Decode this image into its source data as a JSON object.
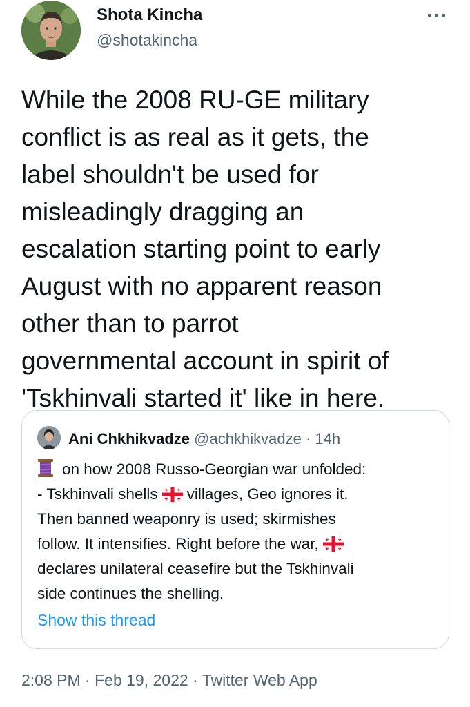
{
  "tweet": {
    "author_name": "Shota Kincha",
    "author_handle": "@shotakincha",
    "text_lines": [
      "While the 2008 RU-GE military",
      "conflict is as real as it gets, the",
      "label shouldn't be used for",
      "misleadingly dragging an",
      "escalation starting point to early",
      "August with no apparent reason",
      "other than to parrot",
      "governmental account in spirit of",
      "'Tskhinvali started it' like in here."
    ],
    "time": "2:08 PM",
    "date": "Feb 19, 2022",
    "source": "Twitter Web App",
    "separator": " · "
  },
  "quote": {
    "author_name": "Ani Chkhikvadze",
    "author_handle": "@achkhikvadze",
    "time": "· 14h",
    "lines": {
      "l1": "on how 2008 Russo-Georgian war unfolded:",
      "l2_before": "- Tskhinvali shells",
      "l2_after": "villages, Geo ignores it.",
      "l3": "Then banned weaponry is used; skirmishes",
      "l4": "follow. It intensifies. Right before the war,",
      "l5": "declares unilateral ceasefire but the Tskhinvali",
      "l6": "side continues the shelling."
    },
    "emoji": {
      "thread": "thread-spool-icon",
      "flag": "georgia-flag-icon"
    },
    "show_thread_label": "Show this thread"
  },
  "colors": {
    "text_primary": "#0f1419",
    "text_secondary": "#536471",
    "link": "#1d9bf0",
    "border": "#cfd9de",
    "flag_red": "#e8112d",
    "thread_purple": "#7e3ea8"
  }
}
